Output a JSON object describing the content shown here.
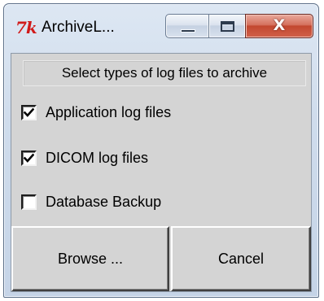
{
  "window": {
    "app_icon": "7k",
    "title": "ArchiveL...",
    "controls": {
      "minimize_icon": "minimize-icon",
      "maximize_icon": "maximize-icon",
      "close_glyph": "X",
      "close_color": "#c2472f"
    }
  },
  "dialog": {
    "heading": "Select types of log files to archive",
    "options": [
      {
        "label": "Application log files",
        "checked": true
      },
      {
        "label": "DICOM log files",
        "checked": true
      },
      {
        "label": "Database Backup",
        "checked": false
      }
    ],
    "buttons": {
      "browse": "Browse ...",
      "cancel": "Cancel"
    }
  }
}
